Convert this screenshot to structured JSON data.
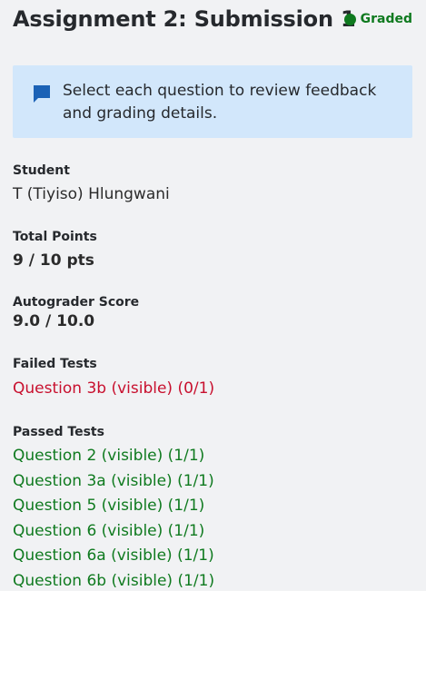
{
  "header": {
    "title": "Assignment 2: Submission 1",
    "status_label": "Graded",
    "status_color": "#0f7a1f"
  },
  "banner": {
    "icon": "comment-icon",
    "text": "Select each question to review feedback and grading details."
  },
  "student": {
    "label": "Student",
    "value": "T (Tiyiso) Hlungwani"
  },
  "total_points": {
    "label": "Total Points",
    "value": "9 / 10 pts"
  },
  "autograder": {
    "label": "Autograder Score",
    "value": "9.0 / 10.0"
  },
  "failed": {
    "label": "Failed Tests",
    "items": [
      "Question 3b (visible) (0/1)"
    ],
    "color": "#c8102e"
  },
  "passed": {
    "label": "Passed Tests",
    "items": [
      "Question 2 (visible) (1/1)",
      "Question 3a (visible) (1/1)",
      "Question 5 (visible) (1/1)",
      "Question 6 (visible) (1/1)",
      "Question 6a (visible) (1/1)",
      "Question 6b (visible) (1/1)"
    ],
    "color": "#0f7a1f"
  }
}
